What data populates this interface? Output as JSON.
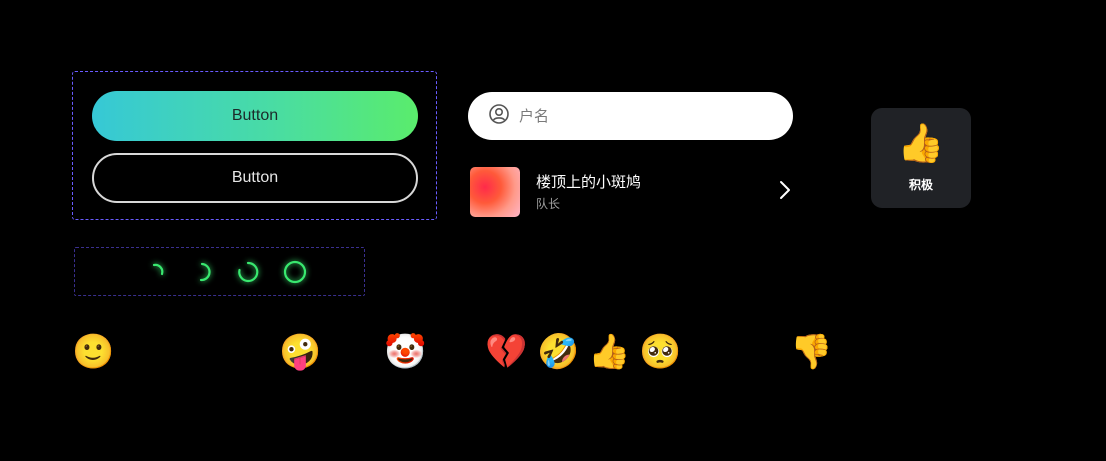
{
  "buttons": {
    "primary_label": "Button",
    "secondary_label": "Button"
  },
  "search": {
    "value": "",
    "placeholder": "户名"
  },
  "list_item": {
    "title": "楼顶上的小斑鸠",
    "subtitle": "队长"
  },
  "reaction_card": {
    "emoji": "👍",
    "label": "积极"
  },
  "emojis": [
    "🙂",
    "😊",
    "😓",
    "😈",
    "🤪",
    "😄",
    "🤡",
    "😫",
    "💔",
    "🤣",
    "👍",
    "🥺",
    "😔",
    "😭",
    "👎",
    "😕",
    "😣",
    "🙃",
    "😠"
  ],
  "colors": {
    "background": "#000000",
    "accent_green": "#39e86f",
    "accent_cyan": "#36c8d6",
    "dashed_border": "#6a5cff"
  }
}
